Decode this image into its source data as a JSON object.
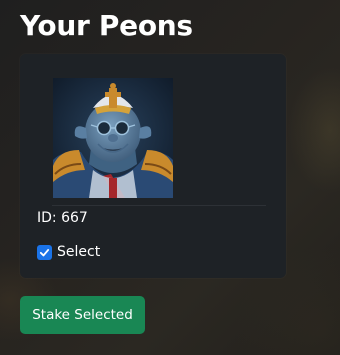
{
  "page": {
    "title": "Your Peons"
  },
  "peons": [
    {
      "id_text": "ID: 667",
      "select_label": "Select",
      "selected": true
    }
  ],
  "actions": {
    "stake_label": "Stake Selected"
  },
  "colors": {
    "button_green": "#198754",
    "checkbox_blue": "#1a73e8",
    "card_background": "#1e2226"
  }
}
